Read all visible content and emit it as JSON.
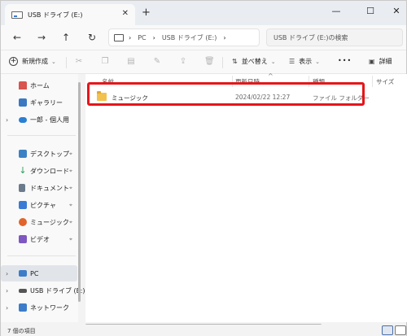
{
  "window": {
    "tab_title": "USB ドライブ (E:)",
    "tab_close": "✕",
    "new_tab": "+",
    "minimize": "—",
    "maximize": "☐",
    "close": "✕"
  },
  "nav": {
    "back": "←",
    "forward": "→",
    "up": "↑",
    "refresh": "↻"
  },
  "address": {
    "separator": "›",
    "crumb_pc": "PC",
    "crumb_drive": "USB ドライブ (E:)",
    "search_placeholder": "USB ドライブ (E:)の検索"
  },
  "commandbar": {
    "new_label": "新規作成",
    "sort_label": "並べ替え",
    "view_label": "表示",
    "more_label": "•••",
    "details_label": "詳細",
    "chevron": "⌄"
  },
  "sidebar": {
    "expand_arrow": "›",
    "pin": "📌",
    "items": [
      {
        "label": "ホーム",
        "color": "#d9534f"
      },
      {
        "label": "ギャラリー",
        "color": "#3a78c2"
      },
      {
        "label": "一郎 - 個人用",
        "color": "#2a7fd4"
      },
      {
        "label": "デスクトップ",
        "color": "#3b82c4"
      },
      {
        "label": "ダウンロード",
        "color": "#2e9e5e"
      },
      {
        "label": "ドキュメント",
        "color": "#6b7b8c"
      },
      {
        "label": "ピクチャ",
        "color": "#3a7bd5"
      },
      {
        "label": "ミュージック",
        "color": "#e0642b"
      },
      {
        "label": "ビデオ",
        "color": "#7e57c2"
      },
      {
        "label": "PC",
        "color": "#3d7cc9"
      },
      {
        "label": "USB ドライブ (E:)",
        "color": "#555555"
      },
      {
        "label": "ネットワーク",
        "color": "#3d7cc9"
      }
    ]
  },
  "table": {
    "headers": {
      "name": "名前",
      "date": "更新日時",
      "type": "種類",
      "size": "サイズ"
    },
    "sort_indicator": "^",
    "rows": [
      {
        "name": "ミュージック",
        "date": "2024/02/22 12:27",
        "type": "ファイル フォルダー",
        "size": ""
      }
    ]
  },
  "status": {
    "count": "7 個の項目"
  },
  "colors": {
    "highlight": "#e5161b",
    "folder": "#f2c14e",
    "selection": "#e1e5ea"
  }
}
